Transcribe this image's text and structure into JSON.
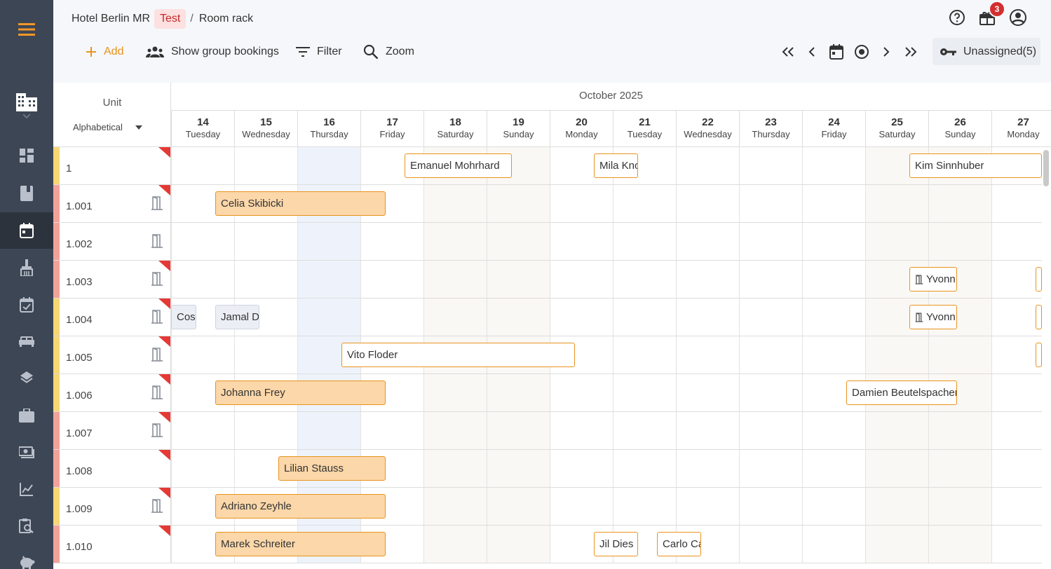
{
  "sidebar": {
    "items": [
      {
        "icon": "menu-icon",
        "active": false
      },
      {
        "icon": "building-icon",
        "active": false
      },
      {
        "icon": "dashboard-icon",
        "active": false
      },
      {
        "icon": "book-icon",
        "active": false
      },
      {
        "icon": "calendar-icon",
        "active": true
      },
      {
        "icon": "broom-icon",
        "active": false
      },
      {
        "icon": "calendar-check-icon",
        "active": false
      },
      {
        "icon": "bed-icon",
        "active": false
      },
      {
        "icon": "layers-icon",
        "active": false
      },
      {
        "icon": "briefcase-icon",
        "active": false
      },
      {
        "icon": "money-icon",
        "active": false
      },
      {
        "icon": "chart-icon",
        "active": false
      },
      {
        "icon": "report-search-icon",
        "active": false
      },
      {
        "icon": "piggy-bank-icon",
        "active": false
      }
    ]
  },
  "header": {
    "breadcrumb": {
      "property": "Hotel Berlin MR",
      "env": "Test",
      "separator": "/",
      "page": "Room rack"
    },
    "notification_count": "3"
  },
  "toolbar": {
    "add": "Add",
    "group": "Show group bookings",
    "filter": "Filter",
    "zoom": "Zoom",
    "unassigned": "Unassigned(5)"
  },
  "grid": {
    "unit_label": "Unit",
    "sort_label": "Alphabetical",
    "month": "October 2025",
    "days": [
      {
        "num": "14",
        "name": "Tuesday"
      },
      {
        "num": "15",
        "name": "Wednesday"
      },
      {
        "num": "16",
        "name": "Thursday"
      },
      {
        "num": "17",
        "name": "Friday"
      },
      {
        "num": "18",
        "name": "Saturday"
      },
      {
        "num": "19",
        "name": "Sunday"
      },
      {
        "num": "20",
        "name": "Monday"
      },
      {
        "num": "21",
        "name": "Tuesday"
      },
      {
        "num": "22",
        "name": "Wednesday"
      },
      {
        "num": "23",
        "name": "Thursday"
      },
      {
        "num": "24",
        "name": "Friday"
      },
      {
        "num": "25",
        "name": "Saturday"
      },
      {
        "num": "26",
        "name": "Sunday"
      },
      {
        "num": "27",
        "name": "Monday"
      }
    ],
    "weekend_days": [
      4,
      5,
      11,
      12
    ],
    "today_index": 2,
    "rows": [
      {
        "unit": "1",
        "stripe": "#f7d774",
        "door": false,
        "flag": true
      },
      {
        "unit": "1.001",
        "stripe": "#f3a29a",
        "door": true,
        "flag": true
      },
      {
        "unit": "1.002",
        "stripe": "#f3a29a",
        "door": true,
        "flag": false
      },
      {
        "unit": "1.003",
        "stripe": "#f3a29a",
        "door": true,
        "flag": true
      },
      {
        "unit": "1.004",
        "stripe": "#f7d774",
        "door": true,
        "flag": true
      },
      {
        "unit": "1.005",
        "stripe": "#f7d774",
        "door": true,
        "flag": true
      },
      {
        "unit": "1.006",
        "stripe": "#f7d774",
        "door": true,
        "flag": true
      },
      {
        "unit": "1.007",
        "stripe": "#f3a29a",
        "door": true,
        "flag": true
      },
      {
        "unit": "1.008",
        "stripe": "#f3a29a",
        "door": false,
        "flag": true
      },
      {
        "unit": "1.009",
        "stripe": "#f7d774",
        "door": true,
        "flag": true
      },
      {
        "unit": "1.010",
        "stripe": "#f3a29a",
        "door": false,
        "flag": true
      }
    ],
    "bookings": [
      {
        "row": 0,
        "start_day": 3.7,
        "nights": 1.7,
        "guest": "Emanuel Mohrhard",
        "style": "white",
        "door": false
      },
      {
        "row": 0,
        "start_day": 6.7,
        "nights": 0.7,
        "guest": "Mila Kno",
        "style": "white",
        "door": false
      },
      {
        "row": 0,
        "start_day": 11.7,
        "nights": 2.15,
        "guest": "Kim Sinnhuber",
        "style": "white",
        "door": false
      },
      {
        "row": 1,
        "start_day": 0.7,
        "nights": 2.7,
        "guest": "Celia Skibicki",
        "style": "orange",
        "door": false
      },
      {
        "row": 3,
        "start_day": 11.7,
        "nights": 0.75,
        "guest": "Yvonn",
        "style": "white",
        "door": true
      },
      {
        "row": 3,
        "start_day": 13.7,
        "nights": 0.2,
        "guest": "",
        "style": "white",
        "door": false
      },
      {
        "row": 4,
        "start_day": 0.0,
        "nights": 0.4,
        "guest": "Cosi",
        "style": "grey",
        "door": false
      },
      {
        "row": 4,
        "start_day": 0.7,
        "nights": 0.7,
        "guest": "Jamal D",
        "style": "grey",
        "door": false
      },
      {
        "row": 4,
        "start_day": 11.7,
        "nights": 0.75,
        "guest": "Yvonn",
        "style": "white",
        "door": true
      },
      {
        "row": 4,
        "start_day": 13.7,
        "nights": 0.2,
        "guest": "",
        "style": "white",
        "door": false
      },
      {
        "row": 5,
        "start_day": 2.7,
        "nights": 3.7,
        "guest": "Vito Floder",
        "style": "white",
        "door": false
      },
      {
        "row": 5,
        "start_day": 13.7,
        "nights": 0.2,
        "guest": "",
        "style": "white",
        "door": false
      },
      {
        "row": 6,
        "start_day": 0.7,
        "nights": 2.7,
        "guest": "Johanna Frey",
        "style": "orange",
        "door": false
      },
      {
        "row": 6,
        "start_day": 10.7,
        "nights": 1.75,
        "guest": "Damien Beutelspacher",
        "style": "white",
        "door": false
      },
      {
        "row": 8,
        "start_day": 1.7,
        "nights": 1.7,
        "guest": "Lilian Stauss",
        "style": "orange",
        "door": false
      },
      {
        "row": 9,
        "start_day": 0.7,
        "nights": 2.7,
        "guest": "Adriano Zeyhle",
        "style": "orange",
        "door": false
      },
      {
        "row": 10,
        "start_day": 0.7,
        "nights": 2.7,
        "guest": "Marek Schreiter",
        "style": "orange",
        "door": false
      },
      {
        "row": 10,
        "start_day": 6.7,
        "nights": 0.7,
        "guest": "Jil Dies",
        "style": "white",
        "door": false
      },
      {
        "row": 10,
        "start_day": 7.7,
        "nights": 0.7,
        "guest": "Carlo Ca",
        "style": "white",
        "door": false
      }
    ]
  }
}
